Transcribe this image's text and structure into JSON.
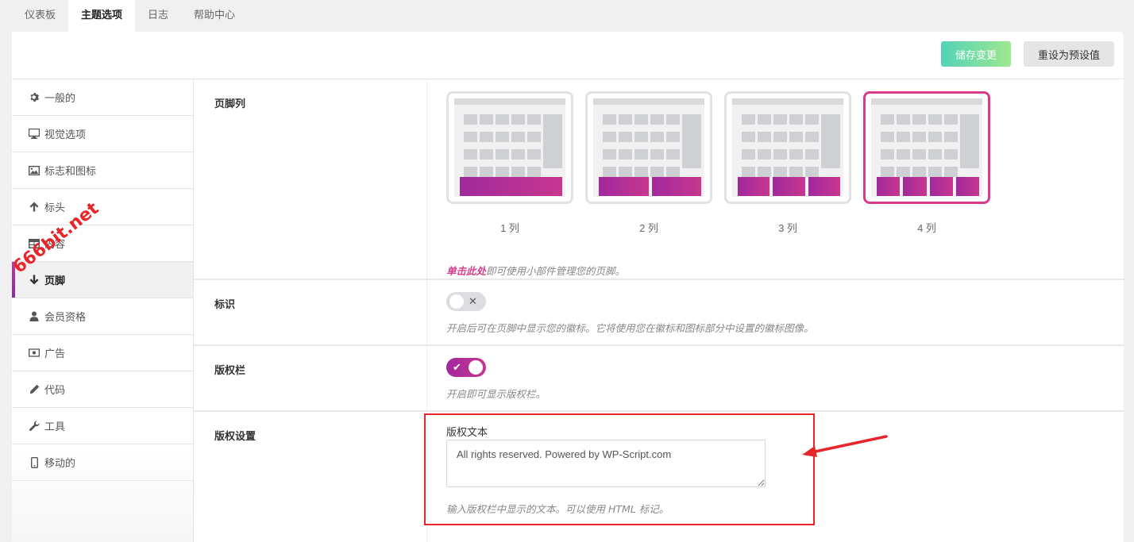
{
  "top_tabs": [
    "仪表板",
    "主题选项",
    "日志",
    "帮助中心"
  ],
  "active_tab": "主题选项",
  "header": {
    "save_label": "储存变更",
    "reset_label": "重设为预设值"
  },
  "sidebar": {
    "items": [
      {
        "label": "一般的",
        "icon": "gear-icon"
      },
      {
        "label": "视觉选项",
        "icon": "monitor-icon"
      },
      {
        "label": "标志和图标",
        "icon": "image-icon"
      },
      {
        "label": "标头",
        "icon": "arrow-up-icon"
      },
      {
        "label": "内容",
        "icon": "table-icon"
      },
      {
        "label": "页脚",
        "icon": "arrow-down-icon"
      },
      {
        "label": "会员资格",
        "icon": "user-icon"
      },
      {
        "label": "广告",
        "icon": "money-icon"
      },
      {
        "label": "代码",
        "icon": "pencil-icon"
      },
      {
        "label": "工具",
        "icon": "wrench-icon"
      },
      {
        "label": "移动的",
        "icon": "mobile-icon"
      }
    ],
    "active": "页脚"
  },
  "footer_columns": {
    "label": "页脚列",
    "options": [
      {
        "label": "1 列",
        "columns": 1
      },
      {
        "label": "2 列",
        "columns": 2
      },
      {
        "label": "3 列",
        "columns": 3
      },
      {
        "label": "4 列",
        "columns": 4
      }
    ],
    "selected": "4 列",
    "hint_link": "单击此处",
    "hint_text": "即可使用小部件管理您的页脚。"
  },
  "logo_row": {
    "label": "标识",
    "toggle_on": false,
    "hint": "开启后可在页脚中显示您的徽标。它将使用您在徽标和图标部分中设置的徽标图像。"
  },
  "copyright_bar": {
    "label": "版权栏",
    "toggle_on": true,
    "hint": "开启即可显示版权栏。"
  },
  "copyright_settings": {
    "label": "版权设置",
    "field_label": "版权文本",
    "value": "All rights reserved. Powered by WP-Script.com",
    "hint": "输入版权栏中显示的文本。可以使用 HTML 标记。"
  },
  "watermark": "666bit.net",
  "colors": {
    "accent": "#d83c8a",
    "save_start": "#52d3b9",
    "save_end": "#9fe88e",
    "annotation": "#e6262b"
  }
}
